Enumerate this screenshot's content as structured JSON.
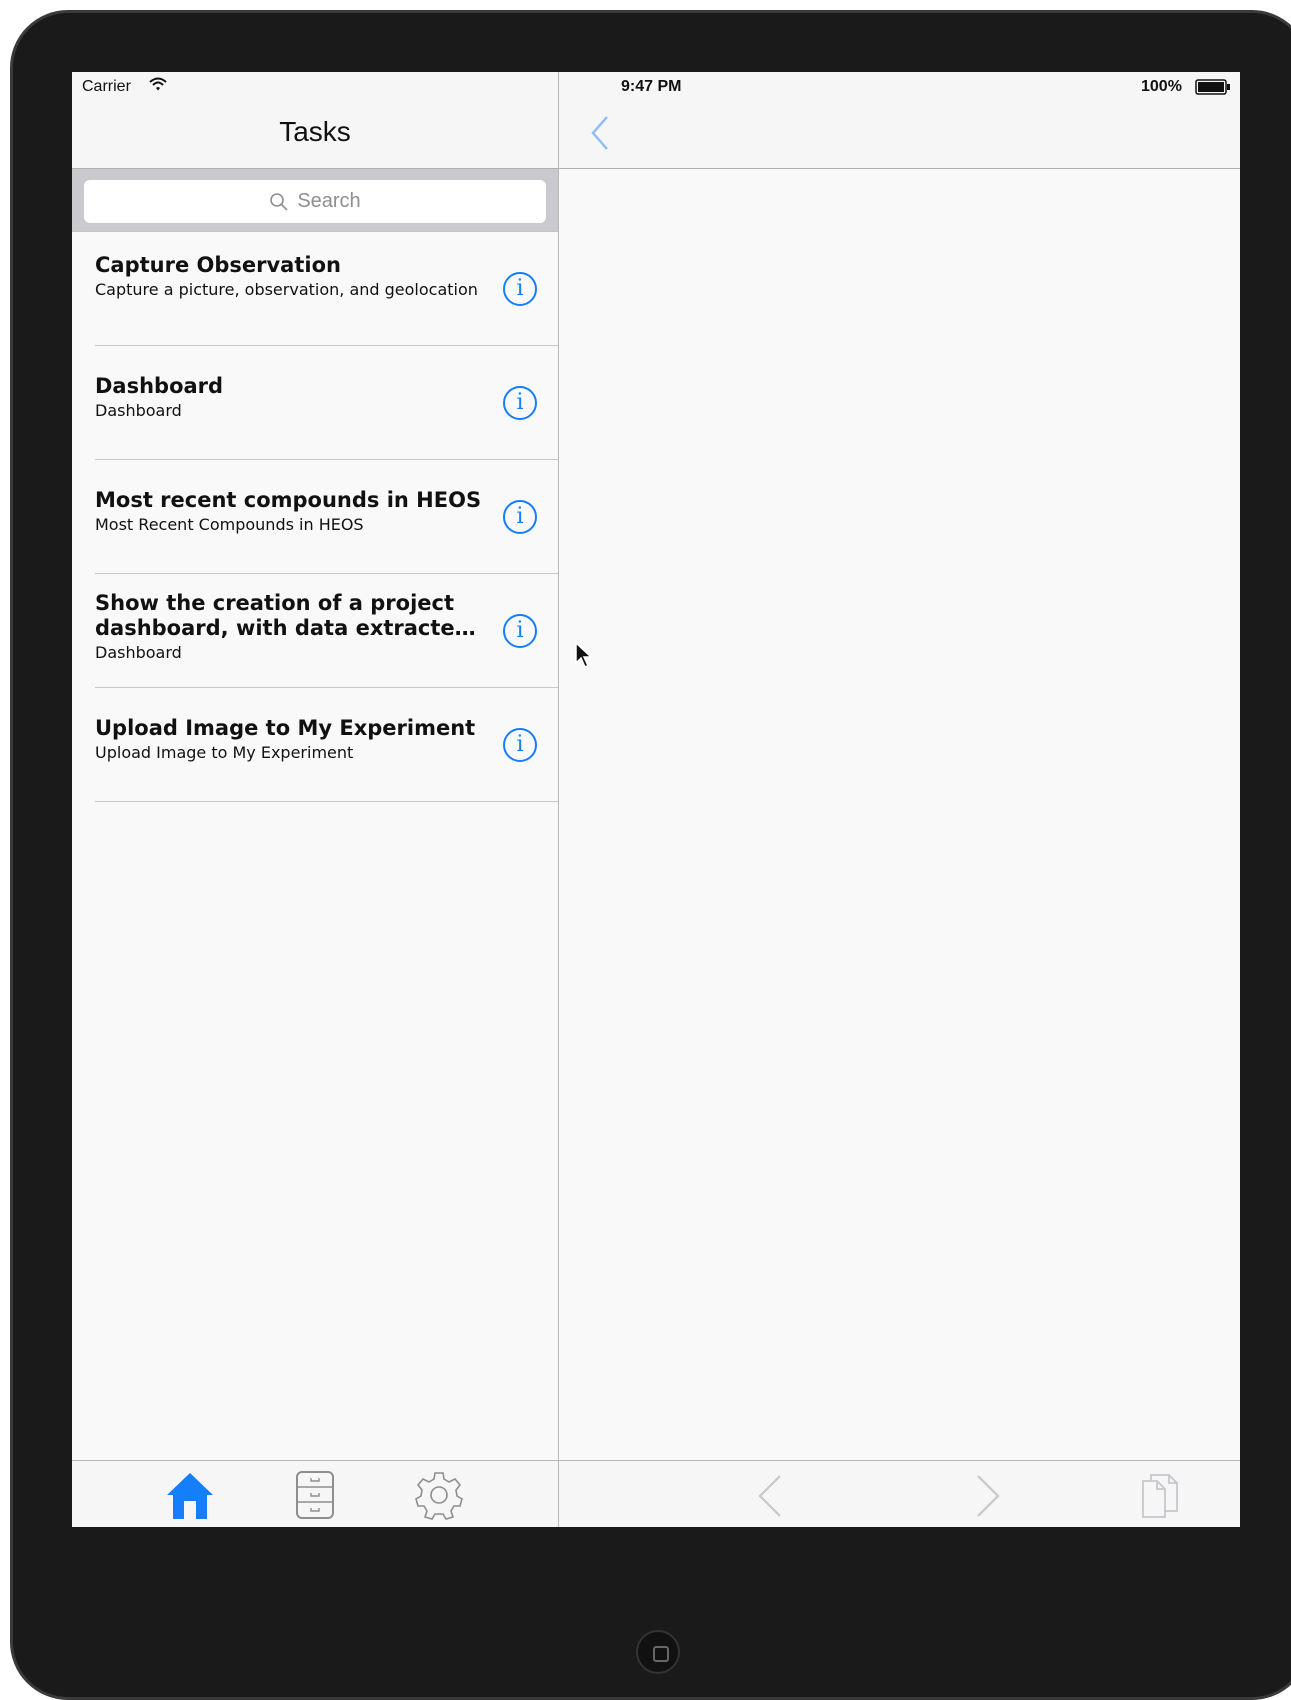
{
  "status_bar": {
    "carrier": "Carrier",
    "time": "9:47 PM",
    "battery": "100%"
  },
  "master": {
    "title": "Tasks",
    "search": {
      "placeholder": "Search"
    },
    "tasks": [
      {
        "title": "Capture Observation",
        "subtitle": "Capture a picture, observation, and geolocation"
      },
      {
        "title": "Dashboard",
        "subtitle": "Dashboard"
      },
      {
        "title": "Most recent compounds in HEOS",
        "subtitle": "Most Recent Compounds in HEOS"
      },
      {
        "title": "Show the creation of a project dashboard, with data extracted from",
        "subtitle": "Dashboard"
      },
      {
        "title": "Upload Image to My Experiment",
        "subtitle": "Upload Image to My Experiment"
      }
    ],
    "tabbar": [
      "home-icon",
      "file-cabinet-icon",
      "gear-icon"
    ]
  },
  "detail": {
    "toolbar": [
      "chevron-left-icon",
      "chevron-right-icon",
      "copy-icon"
    ]
  },
  "colors": {
    "accent": "#147efb",
    "inactive_icon": "#8e8e8e",
    "disabled_icon": "#c7c7cc"
  }
}
